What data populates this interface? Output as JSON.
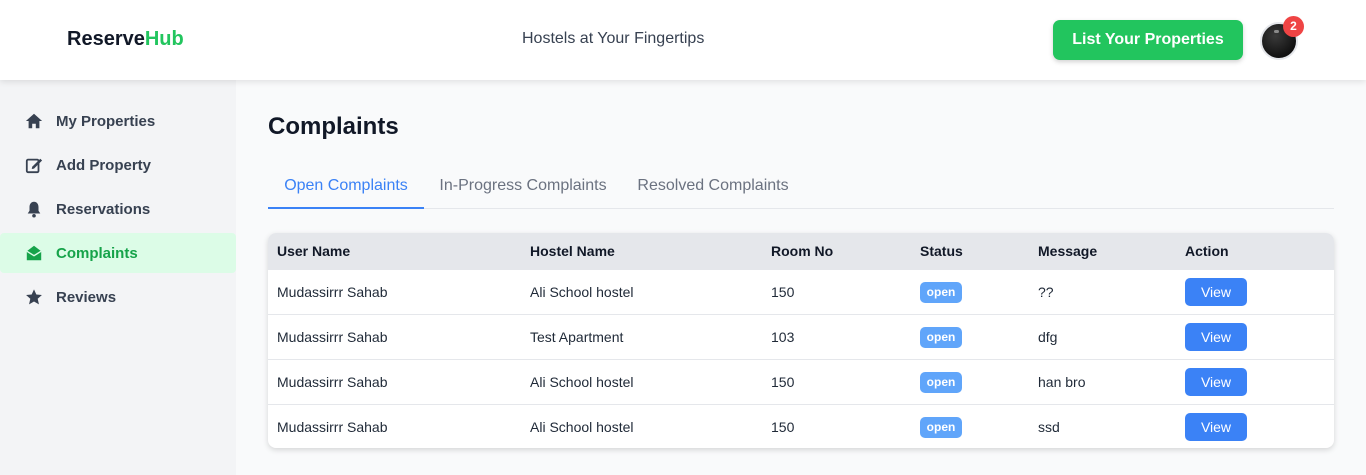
{
  "header": {
    "logo_main": "Reserve",
    "logo_accent": "Hub",
    "tagline": "Hostels at Your Fingertips",
    "list_button": "List Your Properties",
    "notification_count": "2",
    "accent_color": "#22c55e"
  },
  "sidebar": {
    "items": [
      {
        "label": "My Properties",
        "icon": "home-icon"
      },
      {
        "label": "Add Property",
        "icon": "edit-icon"
      },
      {
        "label": "Reservations",
        "icon": "bell-icon"
      },
      {
        "label": "Complaints",
        "icon": "envelope-open-icon",
        "active": true
      },
      {
        "label": "Reviews",
        "icon": "star-icon"
      }
    ]
  },
  "main": {
    "title": "Complaints",
    "tabs": [
      {
        "label": "Open Complaints",
        "active": true
      },
      {
        "label": "In-Progress Complaints"
      },
      {
        "label": "Resolved Complaints"
      }
    ],
    "table": {
      "columns": [
        "User Name",
        "Hostel Name",
        "Room No",
        "Status",
        "Message",
        "Action"
      ],
      "rows": [
        {
          "user": "Mudassirrr Sahab",
          "hostel": "Ali School hostel",
          "room": "150",
          "status": "open",
          "message": "??",
          "action": "View"
        },
        {
          "user": "Mudassirrr Sahab",
          "hostel": "Test Apartment",
          "room": "103",
          "status": "open",
          "message": "dfg",
          "action": "View"
        },
        {
          "user": "Mudassirrr Sahab",
          "hostel": "Ali School hostel",
          "room": "150",
          "status": "open",
          "message": "han bro",
          "action": "View"
        },
        {
          "user": "Mudassirrr Sahab",
          "hostel": "Ali School hostel",
          "room": "150",
          "status": "open",
          "message": "ssd",
          "action": "View"
        }
      ]
    }
  }
}
